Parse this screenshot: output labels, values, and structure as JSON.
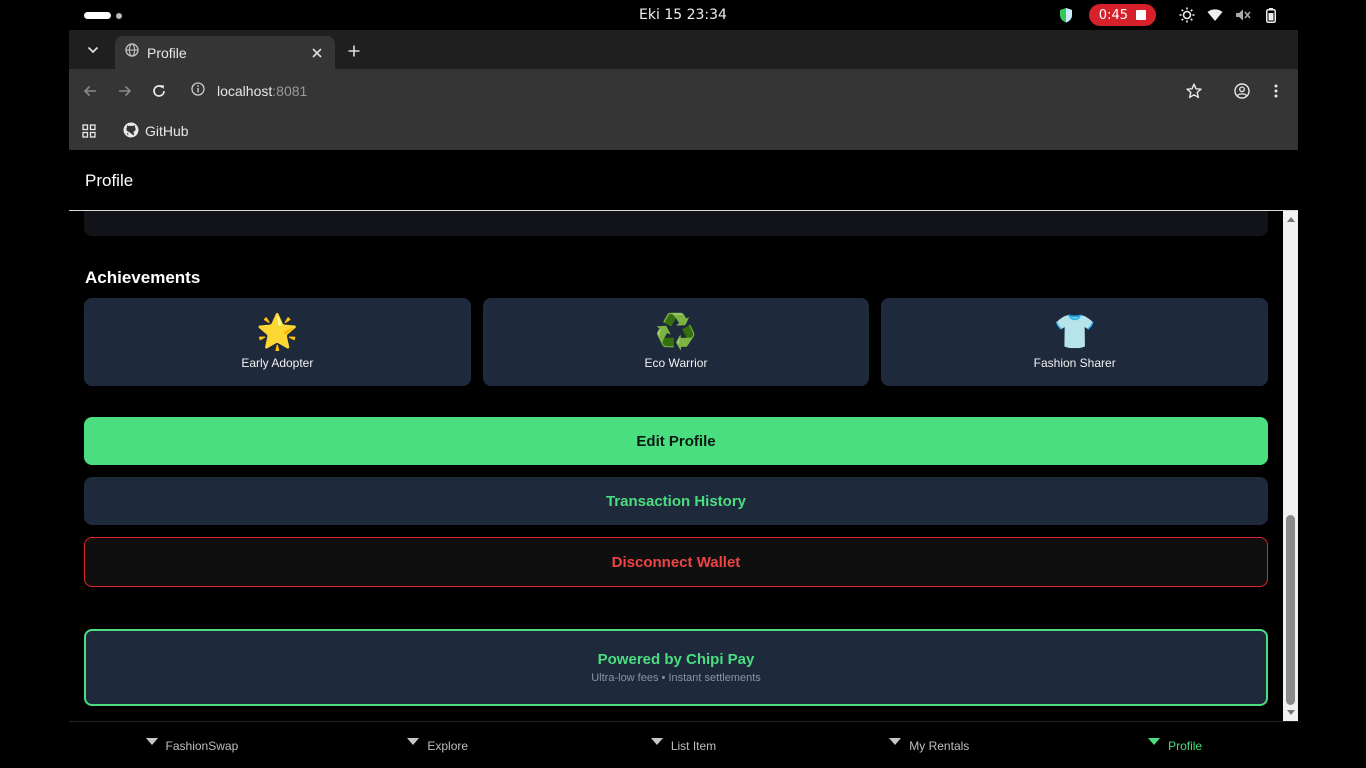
{
  "system": {
    "clock": "Eki 15  23:34",
    "recording_time": "0:45"
  },
  "browser": {
    "tab_title": "Profile",
    "url_host": "localhost",
    "url_port": ":8081",
    "bookmark_github": "GitHub"
  },
  "page": {
    "header_title": "Profile",
    "achievements_title": "Achievements",
    "achievements": [
      {
        "emoji": "🌟",
        "label": "Early Adopter"
      },
      {
        "emoji": "♻️",
        "label": "Eco Warrior"
      },
      {
        "emoji": "👕",
        "label": "Fashion Sharer"
      }
    ],
    "edit_profile_label": "Edit Profile",
    "transaction_history_label": "Transaction History",
    "disconnect_wallet_label": "Disconnect Wallet",
    "powered_title": "Powered by Chipi Pay",
    "powered_subtitle": "Ultra-low fees • Instant settlements"
  },
  "nav": {
    "items": [
      {
        "label": "FashionSwap"
      },
      {
        "label": "Explore"
      },
      {
        "label": "List Item"
      },
      {
        "label": "My Rentals"
      },
      {
        "label": "Profile"
      }
    ]
  },
  "colors": {
    "accent_green": "#4ade80",
    "danger_red": "#ef4444",
    "card_bg": "#1e293b",
    "recording_red": "#d6212b"
  }
}
